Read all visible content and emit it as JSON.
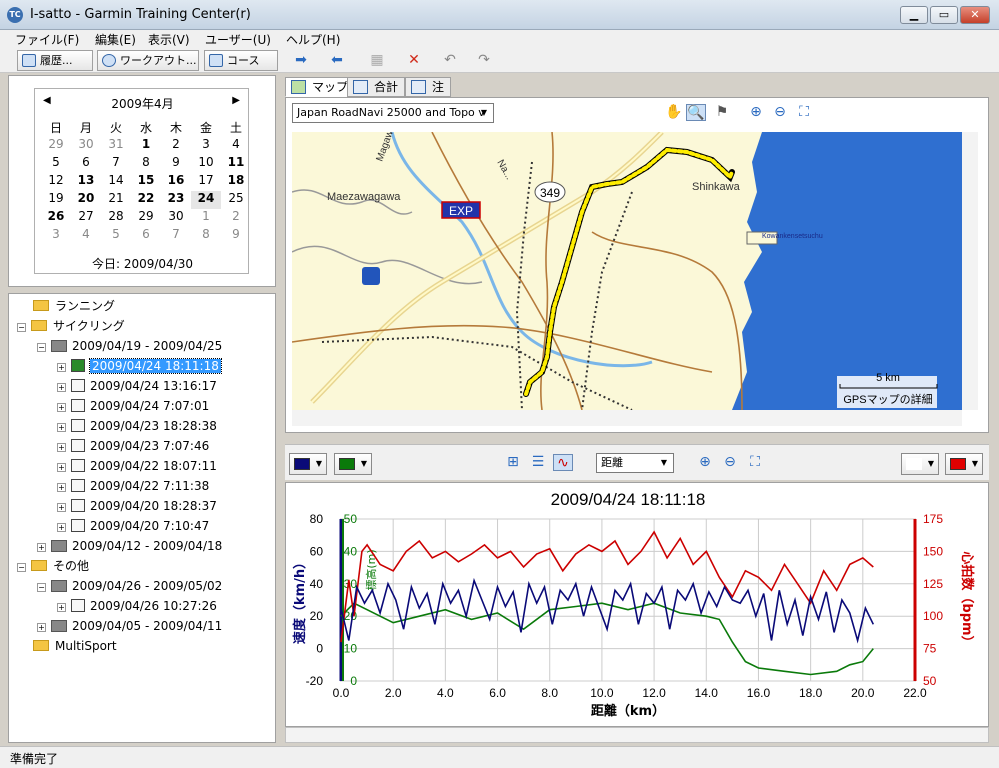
{
  "window": {
    "title": "I-satto - Garmin Training Center(r)",
    "icon_text": "TC"
  },
  "menu": [
    "ファイル(F)",
    "編集(E)",
    "表示(V)",
    "ユーザー(U)",
    "ヘルプ(H)"
  ],
  "toolbar": {
    "history": "履歴...",
    "workout": "ワークアウト...",
    "course": "コース"
  },
  "calendar": {
    "month": "2009年4月",
    "weekdays": [
      "日",
      "月",
      "火",
      "水",
      "木",
      "金",
      "土"
    ],
    "rows": [
      [
        "29",
        "30",
        "31",
        "1",
        "2",
        "3",
        "4"
      ],
      [
        "5",
        "6",
        "7",
        "8",
        "9",
        "10",
        "11"
      ],
      [
        "12",
        "13",
        "14",
        "15",
        "16",
        "17",
        "18"
      ],
      [
        "19",
        "20",
        "21",
        "22",
        "23",
        "24",
        "25"
      ],
      [
        "26",
        "27",
        "28",
        "29",
        "30",
        "1",
        "2"
      ],
      [
        "3",
        "4",
        "5",
        "6",
        "7",
        "8",
        "9"
      ]
    ],
    "today": "今日: 2009/04/30"
  },
  "tree": {
    "running": "ランニング",
    "cycling": "サイクリング",
    "week1": "2009/04/19 - 2009/04/25",
    "activities": [
      "2009/04/24 18:11:18",
      "2009/04/24 13:16:17",
      "2009/04/24 7:07:01",
      "2009/04/23 18:28:38",
      "2009/04/23 7:07:46",
      "2009/04/22 18:07:11",
      "2009/04/22 7:11:38",
      "2009/04/20 18:28:37",
      "2009/04/20 7:10:47"
    ],
    "week2": "2009/04/12 - 2009/04/18",
    "other": "その他",
    "week3": "2009/04/26 - 2009/05/02",
    "other_activity": "2009/04/26 10:27:26",
    "week4": "2009/04/05 - 2009/04/11",
    "multisport": "MultiSport"
  },
  "tabs": {
    "map": "マップ",
    "summary": "合計",
    "notes": "注"
  },
  "map": {
    "layer": "Japan RoadNavi 25000 and Topo v",
    "labels": {
      "maezawagawa": "Maezawagawa",
      "shinkawa": "Shinkawa",
      "route": "349",
      "exp": "EXP",
      "kowan": "Kowankensetsuchu",
      "river": "Magawa",
      "nagase": "Na..."
    },
    "scale": "5 km",
    "detail": "GPSマップの詳細"
  },
  "chart_controls": {
    "xaxis_select": "距離"
  },
  "chart_data": {
    "type": "line",
    "title": "2009/04/24 18:11:18",
    "xlabel": "距離（km）",
    "ylabel_left": "速度（km/h）",
    "ylabel_left2": "標高(m)",
    "ylabel_right": "心拍数（bpm）",
    "xlim": [
      0,
      22
    ],
    "ylim_left": [
      -20,
      80
    ],
    "ylim_left2": [
      0,
      50
    ],
    "ylim_right": [
      50,
      175
    ],
    "x_ticks": [
      "0.0",
      "2.0",
      "4.0",
      "6.0",
      "8.0",
      "10.0",
      "12.0",
      "14.0",
      "16.0",
      "18.0",
      "20.0",
      "22.0"
    ],
    "y_ticks_left": [
      "80",
      "60",
      "40",
      "20",
      "0",
      "-20"
    ],
    "y_ticks_left2": [
      "50",
      "40",
      "30",
      "20",
      "10",
      "0"
    ],
    "y_ticks_right": [
      "175",
      "150",
      "125",
      "100",
      "75",
      "50"
    ],
    "series": [
      {
        "name": "速度",
        "color": "#0a0a78",
        "x": [
          0,
          0.3,
          0.6,
          0.9,
          1.2,
          1.5,
          1.8,
          2.1,
          2.4,
          2.7,
          3.0,
          3.3,
          3.6,
          3.9,
          4.2,
          4.5,
          4.8,
          5.1,
          5.4,
          5.7,
          6.0,
          6.3,
          6.6,
          6.9,
          7.2,
          7.5,
          7.8,
          8.1,
          8.4,
          8.7,
          9.0,
          9.3,
          9.6,
          9.9,
          10.2,
          10.5,
          10.8,
          11.1,
          11.4,
          11.7,
          12.0,
          12.3,
          12.6,
          12.9,
          13.2,
          13.5,
          13.8,
          14.1,
          14.4,
          14.7,
          15.0,
          15.3,
          15.6,
          15.9,
          16.2,
          16.5,
          16.8,
          17.1,
          17.4,
          17.7,
          18.0,
          18.3,
          18.6,
          18.9,
          19.2,
          19.5,
          19.8,
          20.1,
          20.4
        ],
        "values": [
          25,
          5,
          38,
          28,
          36,
          22,
          40,
          30,
          12,
          38,
          25,
          34,
          15,
          40,
          28,
          36,
          20,
          42,
          30,
          18,
          38,
          26,
          35,
          10,
          40,
          28,
          38,
          15,
          36,
          30,
          40,
          20,
          38,
          25,
          12,
          36,
          30,
          40,
          15,
          34,
          28,
          38,
          12,
          36,
          30,
          40,
          22,
          35,
          26,
          38,
          30,
          28,
          36,
          20,
          34,
          5,
          36,
          15,
          30,
          8,
          32,
          18,
          35,
          10,
          30,
          22,
          5,
          25,
          15
        ]
      },
      {
        "name": "標高",
        "color": "#0a7a0a",
        "x": [
          0,
          0.5,
          1,
          2,
          3,
          4,
          5,
          6,
          7,
          8,
          9,
          10,
          11,
          12,
          13,
          14,
          14.5,
          15,
          15.5,
          16,
          17,
          18,
          19,
          19.5,
          20,
          20.4
        ],
        "values": [
          20,
          24,
          22,
          18,
          20,
          22,
          19,
          21,
          16,
          22,
          23,
          24,
          22,
          24,
          21,
          20,
          19,
          12,
          6,
          4,
          3,
          2,
          3,
          5,
          6,
          10
        ]
      },
      {
        "name": "心拍数",
        "color": "#cc0000",
        "x": [
          0,
          0.3,
          0.5,
          0.8,
          1.0,
          1.5,
          2.0,
          2.5,
          3.0,
          3.5,
          4.0,
          4.5,
          5.0,
          5.5,
          6.0,
          6.5,
          7.0,
          7.5,
          8.0,
          8.5,
          9.0,
          9.5,
          10.0,
          10.5,
          11.0,
          11.5,
          12.0,
          12.5,
          13.0,
          13.5,
          14.0,
          14.5,
          15.0,
          15.5,
          16.0,
          16.5,
          17.0,
          17.5,
          18.0,
          18.5,
          19.0,
          19.5,
          20.0,
          20.4
        ],
        "values": [
          80,
          128,
          100,
          150,
          155,
          140,
          135,
          150,
          158,
          145,
          150,
          142,
          148,
          155,
          145,
          150,
          138,
          148,
          152,
          135,
          148,
          155,
          150,
          158,
          140,
          150,
          165,
          145,
          160,
          140,
          150,
          130,
          115,
          135,
          130,
          120,
          140,
          125,
          110,
          135,
          120,
          140,
          145,
          138
        ]
      }
    ]
  },
  "status": "準備完了"
}
